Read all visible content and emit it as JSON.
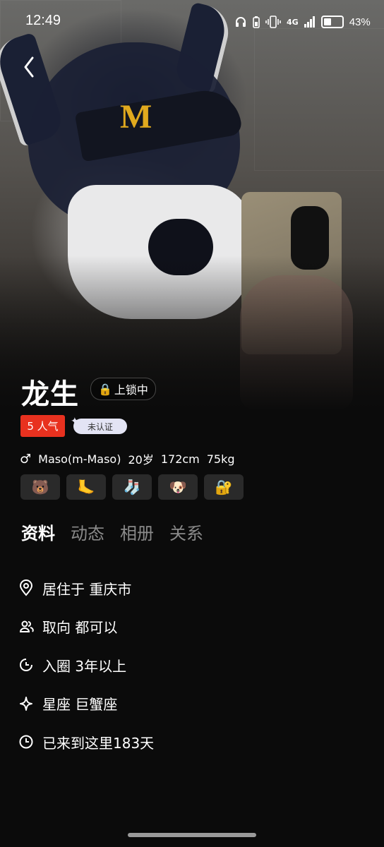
{
  "status_bar": {
    "time": "12:49",
    "network": "4G",
    "battery_percent": "43%",
    "icons": [
      "headphones-icon",
      "battery-saver-icon",
      "vibrate-icon",
      "signal-icon",
      "battery-icon"
    ]
  },
  "profile": {
    "name": "龙生",
    "lock_badge": "上锁中",
    "lock_icon": "🔒",
    "popularity": "5 人气",
    "verification": "未认证",
    "gender_symbol": "♂",
    "role": "Maso(m-Maso)",
    "age": "20岁",
    "height": "172cm",
    "weight": "75kg",
    "emoji_tags": [
      "🐻",
      "🦶",
      "🧦",
      "🐶",
      "🔐"
    ]
  },
  "tabs": [
    {
      "label": "资料",
      "active": true
    },
    {
      "label": "动态",
      "active": false
    },
    {
      "label": "相册",
      "active": false
    },
    {
      "label": "关系",
      "active": false
    }
  ],
  "info": [
    {
      "icon": "location-pin-icon",
      "text": "居住于 重庆市"
    },
    {
      "icon": "people-icon",
      "text": "取向 都可以"
    },
    {
      "icon": "pie-clock-icon",
      "text": "入圈 3年以上"
    },
    {
      "icon": "sparkle-icon",
      "text": "星座 巨蟹座"
    },
    {
      "icon": "clock-icon",
      "text": "已来到这里183天"
    }
  ],
  "colors": {
    "background": "#0b0b0b",
    "popularity_badge": "#e8311f",
    "verify_badge": "#e3e4f4",
    "tab_inactive": "#8a8a8a",
    "logo": "#e0a91e"
  }
}
